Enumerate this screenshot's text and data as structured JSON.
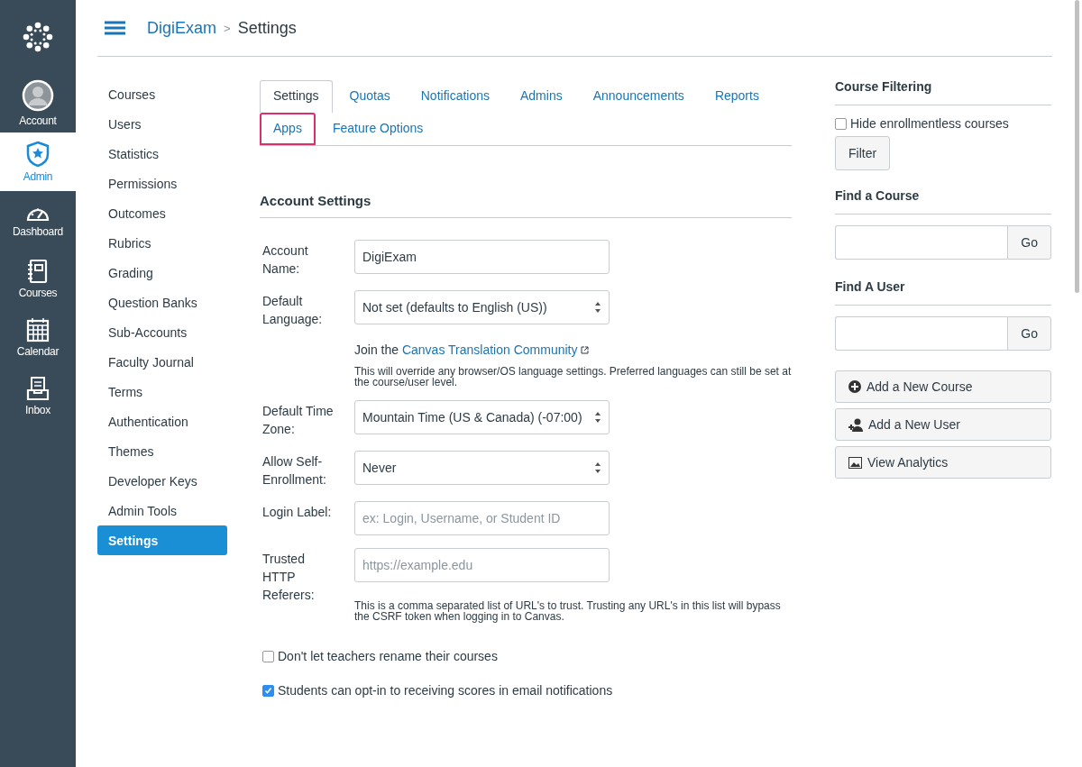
{
  "global_nav": {
    "items": [
      {
        "label": "Account",
        "selected": false
      },
      {
        "label": "Admin",
        "selected": true
      },
      {
        "label": "Dashboard",
        "selected": false
      },
      {
        "label": "Courses",
        "selected": false
      },
      {
        "label": "Calendar",
        "selected": false
      },
      {
        "label": "Inbox",
        "selected": false
      }
    ]
  },
  "breadcrumb": [
    "DigiExam",
    "Settings"
  ],
  "breadcrumb_separator": ">",
  "sub_nav": {
    "items": [
      {
        "label": "Courses",
        "selected": false
      },
      {
        "label": "Users",
        "selected": false
      },
      {
        "label": "Statistics",
        "selected": false
      },
      {
        "label": "Permissions",
        "selected": false
      },
      {
        "label": "Outcomes",
        "selected": false
      },
      {
        "label": "Rubrics",
        "selected": false
      },
      {
        "label": "Grading",
        "selected": false
      },
      {
        "label": "Question Banks",
        "selected": false
      },
      {
        "label": "Sub-Accounts",
        "selected": false
      },
      {
        "label": "Faculty Journal",
        "selected": false
      },
      {
        "label": "Terms",
        "selected": false
      },
      {
        "label": "Authentication",
        "selected": false
      },
      {
        "label": "Themes",
        "selected": false
      },
      {
        "label": "Developer Keys",
        "selected": false
      },
      {
        "label": "Admin Tools",
        "selected": false
      },
      {
        "label": "Settings",
        "selected": true
      }
    ]
  },
  "tabs": [
    {
      "label": "Settings",
      "selected": true,
      "highlighted": false
    },
    {
      "label": "Quotas",
      "selected": false,
      "highlighted": false
    },
    {
      "label": "Notifications",
      "selected": false,
      "highlighted": false
    },
    {
      "label": "Admins",
      "selected": false,
      "highlighted": false
    },
    {
      "label": "Announcements",
      "selected": false,
      "highlighted": false
    },
    {
      "label": "Reports",
      "selected": false,
      "highlighted": false
    },
    {
      "label": "Apps",
      "selected": false,
      "highlighted": true
    },
    {
      "label": "Feature Options",
      "selected": false,
      "highlighted": false
    }
  ],
  "account_settings": {
    "title": "Account Settings",
    "rows": [
      {
        "kind": "text",
        "label": "Account Name:",
        "value": "DigiExam"
      },
      {
        "kind": "select",
        "label": "Default Language:",
        "value": "Not set (defaults to English (US))",
        "link_prefix": "Join the",
        "link": "Canvas Translation Community",
        "note": "This will override any browser/OS language settings. Preferred languages can still be set at the course/user level."
      },
      {
        "kind": "select",
        "label": "Default Time Zone:",
        "value": "Mountain Time (US & Canada) (-07:00)"
      },
      {
        "kind": "select",
        "label": "Allow Self-Enrollment:",
        "value": "Never"
      },
      {
        "kind": "text",
        "label": "Login Label:",
        "placeholder": "ex: Login, Username, or Student ID"
      },
      {
        "kind": "text",
        "label": "Trusted HTTP Referers:",
        "placeholder": "https://example.edu",
        "note": "This is a comma separated list of URL's to trust. Trusting any URL's in this list will bypass the CSRF token when logging in to Canvas."
      }
    ],
    "checkboxes": [
      {
        "label": "Don't let teachers rename their courses",
        "checked": false
      },
      {
        "label": "Students can opt-in to receiving scores in email notifications",
        "checked": true
      }
    ]
  },
  "sidebar": {
    "course_filtering": {
      "title": "Course Filtering",
      "checkbox": {
        "label": "Hide enrollmentless courses",
        "checked": false
      },
      "button": "Filter"
    },
    "find_course": {
      "title": "Find a Course",
      "button": "Go"
    },
    "find_user": {
      "title": "Find A User",
      "button": "Go"
    },
    "actions": [
      "Add a New Course",
      "Add a New User",
      "View Analytics"
    ]
  }
}
